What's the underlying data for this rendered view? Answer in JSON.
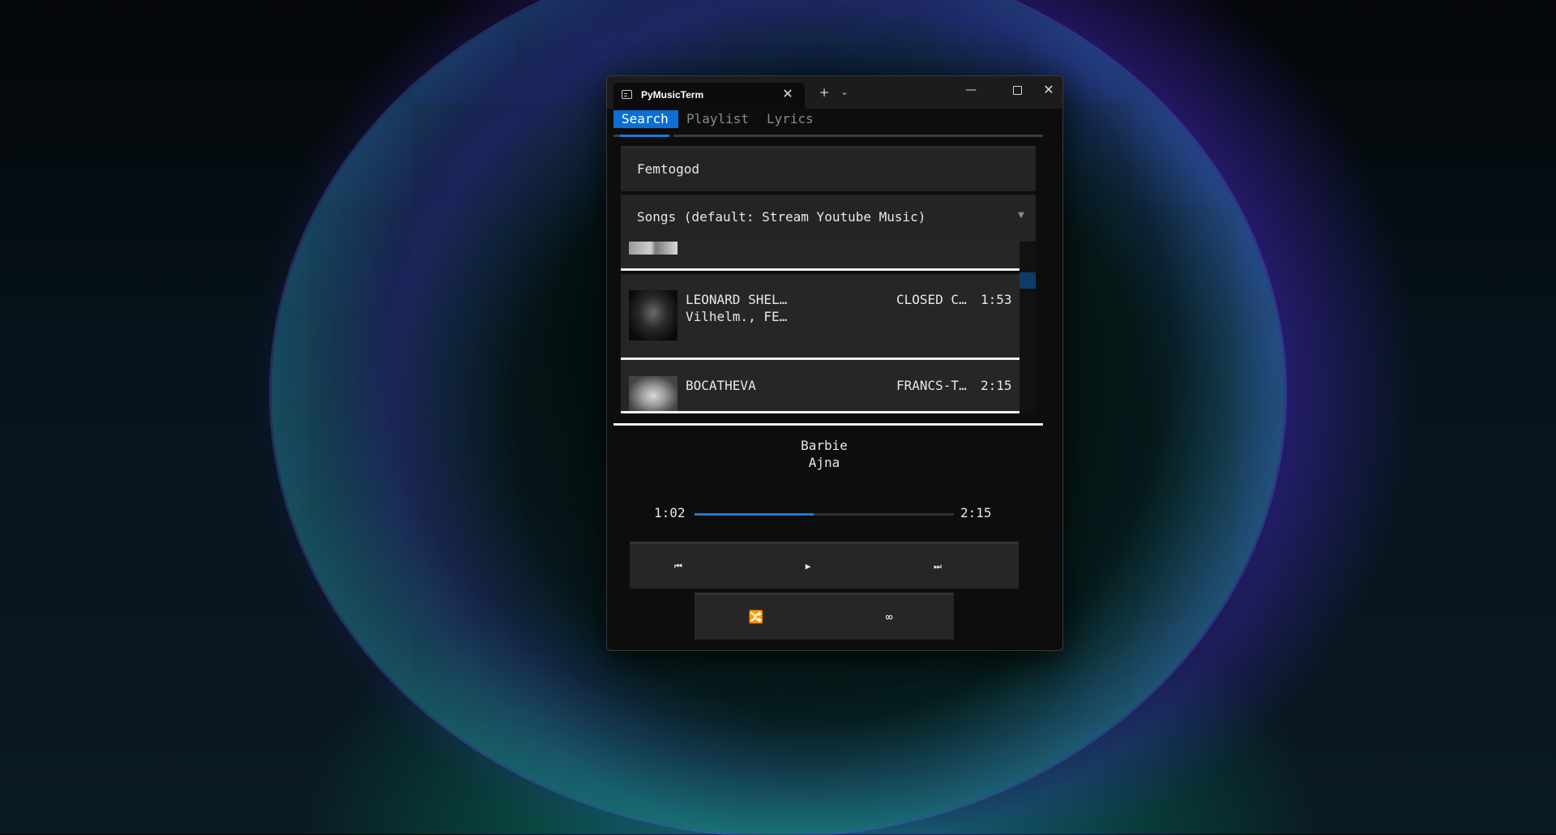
{
  "window": {
    "tab_title": "PyMusicTerm",
    "new_tab": "+",
    "dropdown": "⌄",
    "tab_close": "✕",
    "minimize": "—",
    "close": "✕"
  },
  "app_tabs": [
    "Search",
    "Playlist",
    "Lyrics"
  ],
  "search": {
    "query": "Femtogod",
    "source_select": "Songs (default: Stream Youtube Music)",
    "arrow": "▼"
  },
  "results": [
    {
      "title": "",
      "artist": "",
      "album": "",
      "duration": ""
    },
    {
      "title": "LEONARD SHEL…",
      "artist": "Vilhelm., FE…",
      "album": "CLOSED C…",
      "duration": "1:53"
    },
    {
      "title": "BOCATHEVA",
      "artist": "",
      "album": "FRANCS-T…",
      "duration": "2:15"
    }
  ],
  "now_playing": {
    "title": "Barbie",
    "artist": "Ajna",
    "elapsed": "1:02",
    "total": "2:15",
    "progress": 0.46
  },
  "controls": {
    "previous": "⏮",
    "play": "▶",
    "next": "⏭",
    "shuffle": "🔀",
    "loop": "∞"
  },
  "colors": {
    "accent": "#0b6fd3",
    "panel": "#242424",
    "background": "#0d0d0d"
  }
}
